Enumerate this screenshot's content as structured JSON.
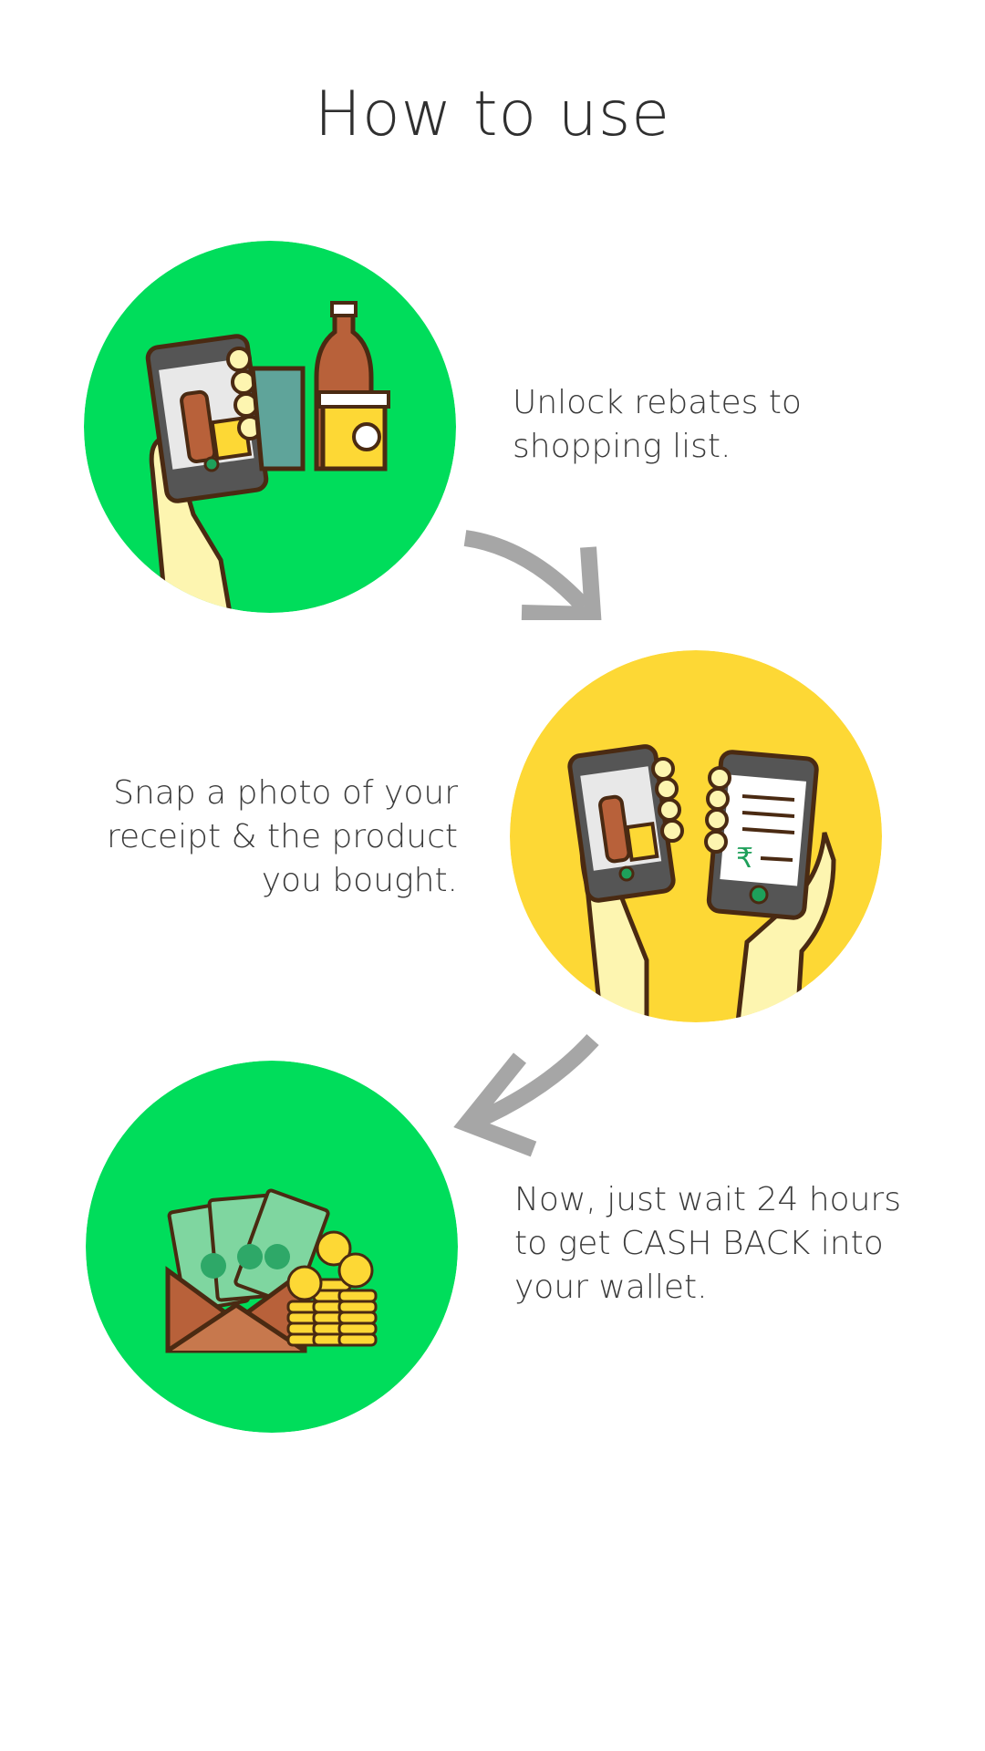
{
  "header": {
    "title": "How to use"
  },
  "steps": [
    {
      "text": "Unlock rebates to\nshopping list.",
      "circle_color": "#00dd5b",
      "icon": "phone-with-products-icon"
    },
    {
      "text": "Snap a photo of your\nreceipt & the product\nyou bought.",
      "circle_color": "#fdd835",
      "icon": "phones-receipt-icon"
    },
    {
      "text": "Now, just wait 24 hours\nto get CASH BACK into\nyour wallet.",
      "circle_color": "#00dd5b",
      "icon": "wallet-cash-icon"
    }
  ],
  "colors": {
    "green": "#00dd5b",
    "yellow": "#fdd835",
    "arrow": "#a6a6a6",
    "text": "#333333"
  }
}
